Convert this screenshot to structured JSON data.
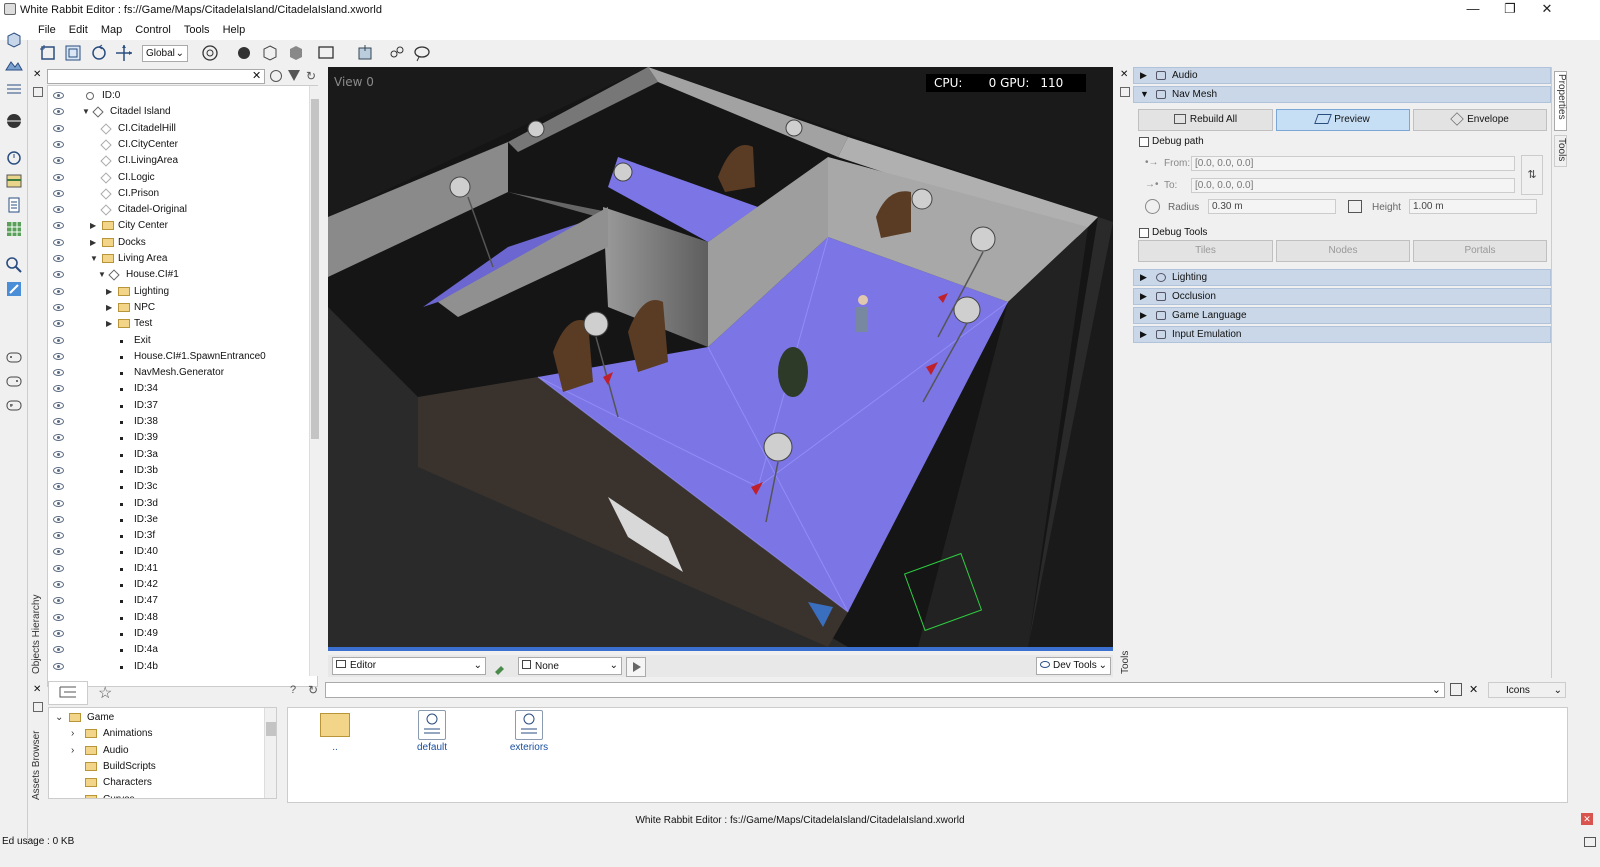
{
  "window": {
    "title": "White Rabbit Editor : fs://Game/Maps/CitadelaIsland/CitadelaIsland.xworld",
    "minimize": "—",
    "maximize": "❐",
    "close": "✕"
  },
  "menu": [
    "File",
    "Edit",
    "Map",
    "Control",
    "Tools",
    "Help"
  ],
  "toolbar": {
    "space_select": "Global"
  },
  "hierarchy": {
    "label": "Objects Hierarchy",
    "search_placeholder": "",
    "rows": [
      {
        "label": "ID:0",
        "indent": 0,
        "kind": "world"
      },
      {
        "label": "Citadel Island",
        "indent": 1,
        "kind": "diamond",
        "expanded": true
      },
      {
        "label": "CI.CitadelHill",
        "indent": 2,
        "kind": "diamond-empty"
      },
      {
        "label": "CI.CityCenter",
        "indent": 2,
        "kind": "diamond-empty"
      },
      {
        "label": "CI.LivingArea",
        "indent": 2,
        "kind": "diamond-empty"
      },
      {
        "label": "CI.Logic",
        "indent": 2,
        "kind": "diamond-empty"
      },
      {
        "label": "CI.Prison",
        "indent": 2,
        "kind": "diamond-empty"
      },
      {
        "label": "Citadel-Original",
        "indent": 2,
        "kind": "diamond-empty"
      },
      {
        "label": "City Center",
        "indent": 2,
        "kind": "folder",
        "expanded": false
      },
      {
        "label": "Docks",
        "indent": 2,
        "kind": "folder",
        "expanded": false
      },
      {
        "label": "Living Area",
        "indent": 2,
        "kind": "folder",
        "expanded": true
      },
      {
        "label": "House.CI#1",
        "indent": 3,
        "kind": "diamond",
        "expanded": true
      },
      {
        "label": "Lighting",
        "indent": 4,
        "kind": "folder",
        "expanded": false
      },
      {
        "label": "NPC",
        "indent": 4,
        "kind": "folder",
        "expanded": false
      },
      {
        "label": "Test",
        "indent": 4,
        "kind": "folder",
        "expanded": false
      },
      {
        "label": "Exit",
        "indent": 4,
        "kind": "bullet"
      },
      {
        "label": "House.CI#1.SpawnEntrance0",
        "indent": 4,
        "kind": "bullet"
      },
      {
        "label": "NavMesh.Generator",
        "indent": 4,
        "kind": "bullet"
      },
      {
        "label": "ID:34",
        "indent": 4,
        "kind": "bullet"
      },
      {
        "label": "ID:37",
        "indent": 4,
        "kind": "bullet"
      },
      {
        "label": "ID:38",
        "indent": 4,
        "kind": "bullet"
      },
      {
        "label": "ID:39",
        "indent": 4,
        "kind": "bullet"
      },
      {
        "label": "ID:3a",
        "indent": 4,
        "kind": "bullet"
      },
      {
        "label": "ID:3b",
        "indent": 4,
        "kind": "bullet"
      },
      {
        "label": "ID:3c",
        "indent": 4,
        "kind": "bullet"
      },
      {
        "label": "ID:3d",
        "indent": 4,
        "kind": "bullet"
      },
      {
        "label": "ID:3e",
        "indent": 4,
        "kind": "bullet"
      },
      {
        "label": "ID:3f",
        "indent": 4,
        "kind": "bullet"
      },
      {
        "label": "ID:40",
        "indent": 4,
        "kind": "bullet"
      },
      {
        "label": "ID:41",
        "indent": 4,
        "kind": "bullet"
      },
      {
        "label": "ID:42",
        "indent": 4,
        "kind": "bullet"
      },
      {
        "label": "ID:47",
        "indent": 4,
        "kind": "bullet"
      },
      {
        "label": "ID:48",
        "indent": 4,
        "kind": "bullet"
      },
      {
        "label": "ID:49",
        "indent": 4,
        "kind": "bullet"
      },
      {
        "label": "ID:4a",
        "indent": 4,
        "kind": "bullet"
      },
      {
        "label": "ID:4b",
        "indent": 4,
        "kind": "bullet"
      }
    ]
  },
  "viewport": {
    "view_label": "View 0",
    "cpu_label": "CPU:",
    "cpu_value": "0",
    "gpu_label": "GPU:",
    "gpu_value": "110",
    "mode_select": "Editor",
    "filter_select": "None",
    "dev_tools": "Dev Tools"
  },
  "properties": {
    "side_tabs": [
      "Properties",
      "Tools"
    ],
    "right_tools_label": "Tools",
    "sections": {
      "audio": "Audio",
      "navmesh": "Nav Mesh",
      "lighting": "Lighting",
      "occlusion": "Occlusion",
      "game_language": "Game Language",
      "input_emulation": "Input Emulation"
    },
    "navmesh": {
      "rebuild_all": "Rebuild All",
      "preview": "Preview",
      "envelope": "Envelope",
      "debug_path": "Debug path",
      "from_label": "From:",
      "from_value": "[0.0, 0.0, 0.0]",
      "to_label": "To:",
      "to_value": "[0.0, 0.0, 0.0]",
      "radius_label": "Radius",
      "radius_value": "0.30 m",
      "height_label": "Height",
      "height_value": "1.00 m",
      "debug_tools": "Debug Tools",
      "tiles": "Tiles",
      "nodes": "Nodes",
      "portals": "Portals"
    }
  },
  "assets": {
    "label": "Assets Browser",
    "view_select": "Icons",
    "tree": [
      {
        "label": "Game",
        "indent": 0,
        "expanded": true
      },
      {
        "label": "Animations",
        "indent": 1,
        "expanded": false
      },
      {
        "label": "Audio",
        "indent": 1,
        "expanded": false
      },
      {
        "label": "BuildScripts",
        "indent": 1
      },
      {
        "label": "Characters",
        "indent": 1
      },
      {
        "label": "Curves",
        "indent": 1
      }
    ],
    "items": [
      {
        "label": "..",
        "type": "folder"
      },
      {
        "label": "default",
        "type": "file"
      },
      {
        "label": "exteriors",
        "type": "file"
      }
    ]
  },
  "status": {
    "center": "White Rabbit Editor : fs://Game/Maps/CitadelaIsland/CitadelaIsland.xworld",
    "left": "Ed usage : 0 KB"
  }
}
